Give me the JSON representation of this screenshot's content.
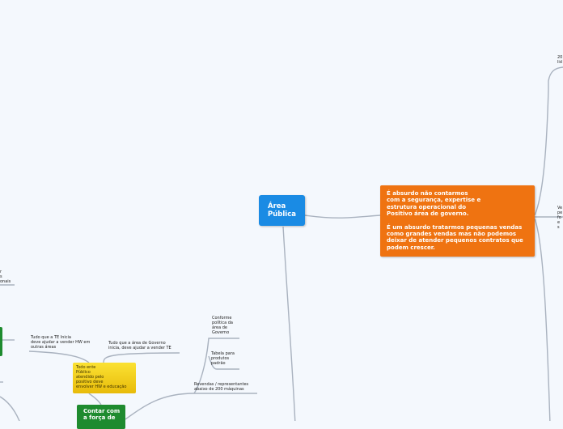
{
  "nodes": {
    "root": "Área\nPública",
    "orange_p1": "É absurdo não contarmos\ncom a segurança, expertise e\nestrutura operacional  do\nPositivo área de governo.",
    "orange_p2": "É um absurdo tratarmos pequenas  vendas\ncomo grandes vendas mas não podemos\ndeixar de atender pequenos contratos que\npodem crescer.",
    "yellow": "Todo ente\nPúblico\natendido pelo\npositivo deve\nenvolver HW e  educação",
    "green": "Contar com\na força de",
    "te_inicia": "Tudo que a TE Inicia\ndeve ajudar a vender HW em\noutras áreas",
    "gov_inicia": "Tudo que a área de Governo\ninicia, deve ajudar a vender TE",
    "conforme": "Conforme\npolítica da\nárea de\nGoverno",
    "tabela": "Tabela para\nprodutos\npadrão",
    "revendas": "Revendas / representantes\nabaixo de 200 máquinas",
    "right_top_clip": "20\nlid",
    "right_mid_clip": "Ve\npe\nfo\ne s",
    "left_clip": "r\ns\nonais"
  },
  "colors": {
    "root": "#1a8be4",
    "orange": "#ef7311",
    "yellow": "#f5d21e",
    "green": "#1e8b2f",
    "line": "#a9b2bf"
  }
}
